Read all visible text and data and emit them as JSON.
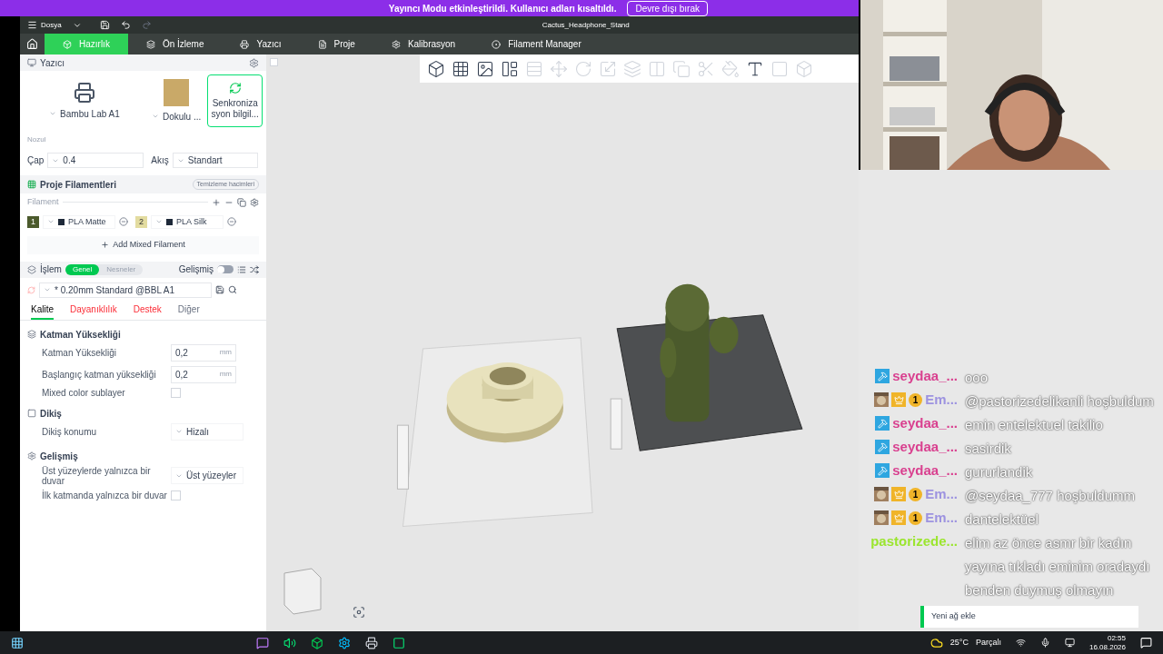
{
  "banner": {
    "message": "Yayıncı Modu etkinleştirildi. Kullanıcı adları kısaltıldı.",
    "button": "Devre dışı bırak"
  },
  "titlebar": {
    "menu": "Dosya",
    "title": "Cactus_Headphone_Stand"
  },
  "tabs": [
    {
      "label": "Hazırlık",
      "kind": "prepare",
      "selected": true
    },
    {
      "label": "Ön İzleme",
      "kind": "preview",
      "selected": false
    },
    {
      "label": "Yazıcı",
      "kind": "printer",
      "selected": false
    },
    {
      "label": "Proje",
      "kind": "project",
      "selected": false
    },
    {
      "label": "Kalibrasyon",
      "kind": "calibration",
      "selected": false
    },
    {
      "label": "Filament Manager",
      "kind": "filament",
      "selected": false
    }
  ],
  "printer": {
    "title": "Yazıcı",
    "model": "Bambu Lab A1",
    "plate": "Dokulu ...",
    "sync": "Senkroniza syon bilgil...",
    "nozzle_label": "Nozul",
    "diameter_label": "Çap",
    "diameter": "0.4",
    "flow_label": "Akış",
    "flow": "Standart"
  },
  "filaments": {
    "title": "Proje Filamentleri",
    "badge": "Temizleme hacimleri",
    "label": "Filament",
    "add": "Add Mixed Filament",
    "items": [
      {
        "index": "1",
        "name": "PLA Matte",
        "color": "#4b5a2c"
      },
      {
        "index": "2",
        "name": "PLA Silk",
        "color": "#e3dca0"
      }
    ]
  },
  "process": {
    "title": "İşlem",
    "modes": [
      {
        "label": "Genel",
        "selected": true
      },
      {
        "label": "Nesneler",
        "selected": false
      }
    ],
    "advanced_label": "Gelişmiş",
    "advanced_on": false,
    "preset": "* 0.20mm Standard @BBL A1",
    "subtabs": [
      {
        "label": "Kalite",
        "selected": true,
        "modified": false
      },
      {
        "label": "Dayanıklılık",
        "selected": false,
        "modified": true
      },
      {
        "label": "Destek",
        "selected": false,
        "modified": true
      },
      {
        "label": "Diğer",
        "selected": false,
        "modified": false
      }
    ]
  },
  "sections": [
    {
      "title": "Katman Yüksekliği",
      "kind": "layers",
      "rows": [
        {
          "kind": "number",
          "label": "Katman Yüksekliği",
          "value": "0,2",
          "unit": "mm"
        },
        {
          "kind": "number",
          "label": "Başlangıç katman yüksekliği",
          "value": "0,2",
          "unit": "mm"
        },
        {
          "kind": "checkbox",
          "label": "Mixed color sublayer",
          "checked": false
        }
      ]
    },
    {
      "title": "Dikiş",
      "kind": "seam",
      "rows": [
        {
          "kind": "select",
          "label": "Dikiş konumu",
          "value": "Hizalı"
        }
      ]
    },
    {
      "title": "Gelişmiş",
      "kind": "advanced",
      "rows": [
        {
          "kind": "select",
          "label": "Üst yüzeylerde yalnızca bir duvar",
          "value": "Üst yüzeyler"
        },
        {
          "kind": "checkbox",
          "label": "İlk katmanda yalnızca bir duvar",
          "checked": false
        }
      ]
    }
  ],
  "chat": [
    {
      "kind": "mod",
      "user": "seydaa_...",
      "color": "#d9408f",
      "message": "ooo"
    },
    {
      "kind": "sub",
      "badge": "1",
      "user": "Em...",
      "color": "#9d93e0",
      "message": "@pastorizedelikanli hoşbuldum"
    },
    {
      "kind": "mod",
      "user": "seydaa_...",
      "color": "#d9408f",
      "message": "emin entelektuel takilio"
    },
    {
      "kind": "mod",
      "user": "seydaa_...",
      "color": "#d9408f",
      "message": "sasirdik"
    },
    {
      "kind": "mod",
      "user": "seydaa_...",
      "color": "#d9408f",
      "message": "gururlandik"
    },
    {
      "kind": "sub",
      "badge": "1",
      "user": "Em...",
      "color": "#9d93e0",
      "message": "@seydaa_777 hoşbuldumm"
    },
    {
      "kind": "sub",
      "badge": "1",
      "user": "Em...",
      "color": "#9d93e0",
      "message": "dantelektüel"
    },
    {
      "kind": "plain",
      "user": "pastorizede...",
      "color": "#9be52e",
      "message": "elim az önce asmr bir kadın yayına tıkladı eminim oradaydı benden duymuş olmayın"
    }
  ],
  "toast": {
    "text": "Yeni ağ ekle"
  },
  "taskbar": {
    "temperature": "25°C",
    "weather": "Parçalı",
    "time": "02:55",
    "date": "16.08.2026"
  }
}
